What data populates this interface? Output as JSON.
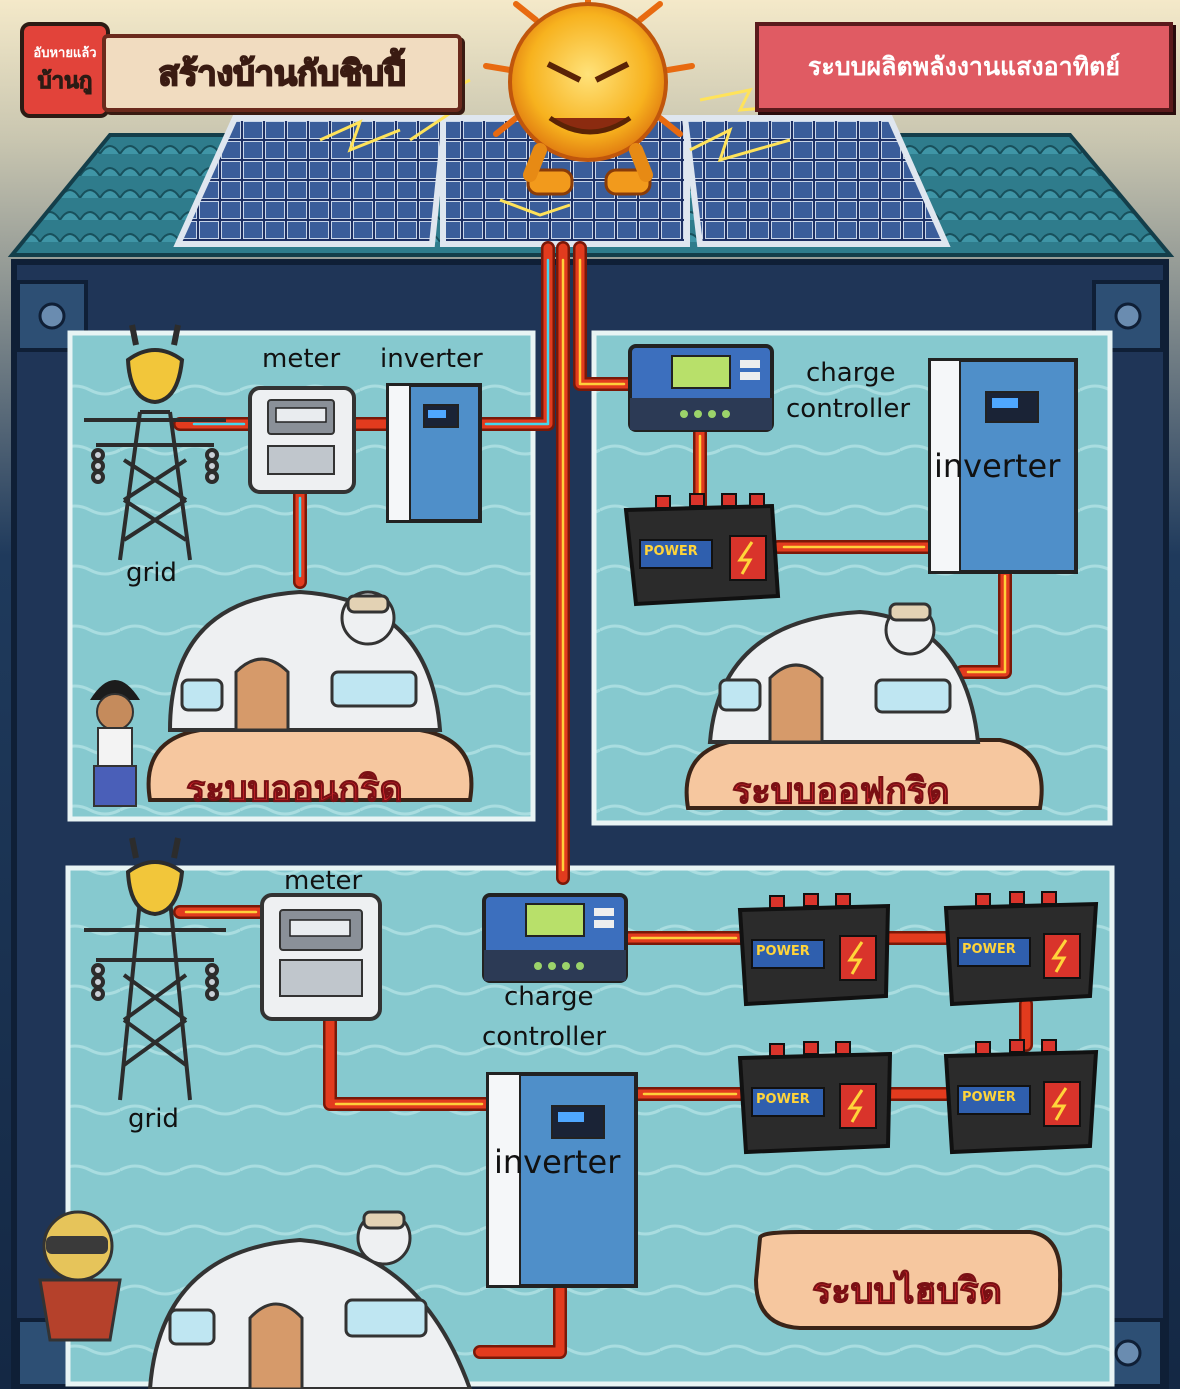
{
  "header": {
    "logo_line1": "อับหายแล้ว",
    "logo_line2": "บ้านกู",
    "title": "สร้างบ้านกับชิบปี้",
    "subtitle": "ระบบผลิตพลังงานแสงอาทิตย์"
  },
  "on_grid": {
    "meter_label": "meter",
    "inverter_label": "inverter",
    "grid_label": "grid",
    "system_name": "ระบบออนกริด"
  },
  "off_grid": {
    "charge_controller_label_1": "charge",
    "charge_controller_label_2": "controller",
    "inverter_label": "inverter",
    "system_name": "ระบบออฟกริด"
  },
  "hybrid": {
    "meter_label": "meter",
    "grid_label": "grid",
    "charge_controller_label_1": "charge",
    "charge_controller_label_2": "controller",
    "inverter_label": "inverter",
    "system_name": "ระบบไฮบริด"
  },
  "battery_text": "POWER",
  "colors": {
    "wire_red": "#e23b1e",
    "wire_glow": "#ffcf3a",
    "panel_bg": "#7fc3cb",
    "frame": "#1f3557",
    "device_blue": "#4f8fc9"
  }
}
